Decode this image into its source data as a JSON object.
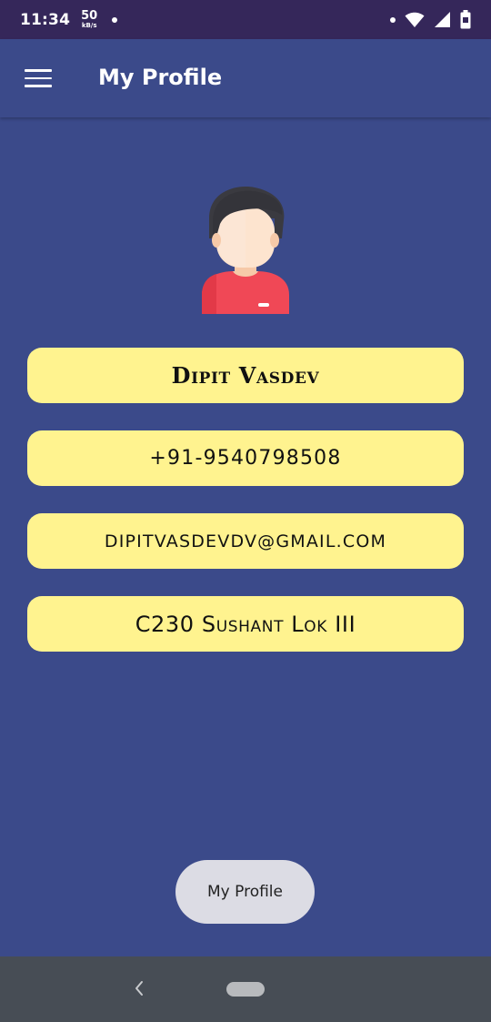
{
  "status_bar": {
    "time": "11:34",
    "net_speed_value": "50",
    "net_speed_unit": "kB/s",
    "icons": [
      "notification-dot-icon",
      "wifi-icon",
      "signal-icon",
      "battery-icon"
    ]
  },
  "app_bar": {
    "title": "My Profile",
    "menu_icon": "hamburger-menu-icon"
  },
  "profile": {
    "avatar_icon": "user-avatar-icon",
    "name": "Dipit Vasdev",
    "phone": "+91-9540798508",
    "email": "dipitvasdevdv@gmail.com",
    "address": "C230 Sushant Lok III"
  },
  "bottom_chip": {
    "label": "My Profile"
  },
  "nav_bar": {
    "back_icon": "back-chevron-icon",
    "home_icon": "home-pill-icon"
  },
  "colors": {
    "background": "#3b4a8a",
    "status_bar": "#35275a",
    "pill": "#fff38f",
    "chip": "#dcdce4",
    "nav_bar": "#474d55"
  }
}
